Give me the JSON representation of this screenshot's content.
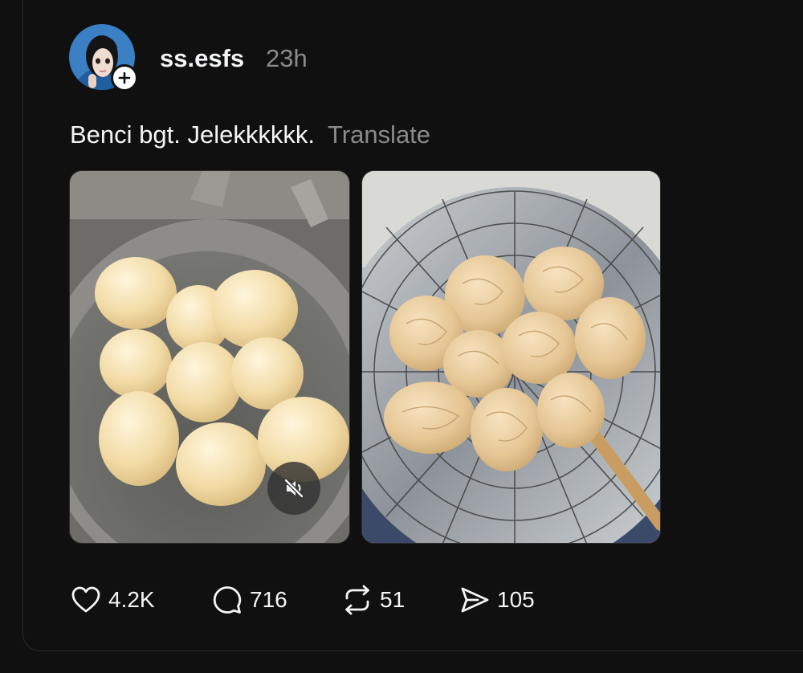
{
  "post": {
    "author": {
      "username": "ss.esfs",
      "timestamp": "23h"
    },
    "caption": "Benci bgt. Jelekkkkkk.",
    "translate_label": "Translate",
    "media": [
      {
        "kind": "video",
        "muted": true,
        "icon": "speaker-muted-icon"
      },
      {
        "kind": "image"
      }
    ],
    "actions": {
      "likes": "4.2K",
      "replies": "716",
      "reposts": "51",
      "shares": "105"
    }
  },
  "colors": {
    "background": "#101010",
    "text_primary": "#f3f5f7",
    "text_secondary": "#8a8a8a",
    "divider": "#2a2a2a"
  }
}
